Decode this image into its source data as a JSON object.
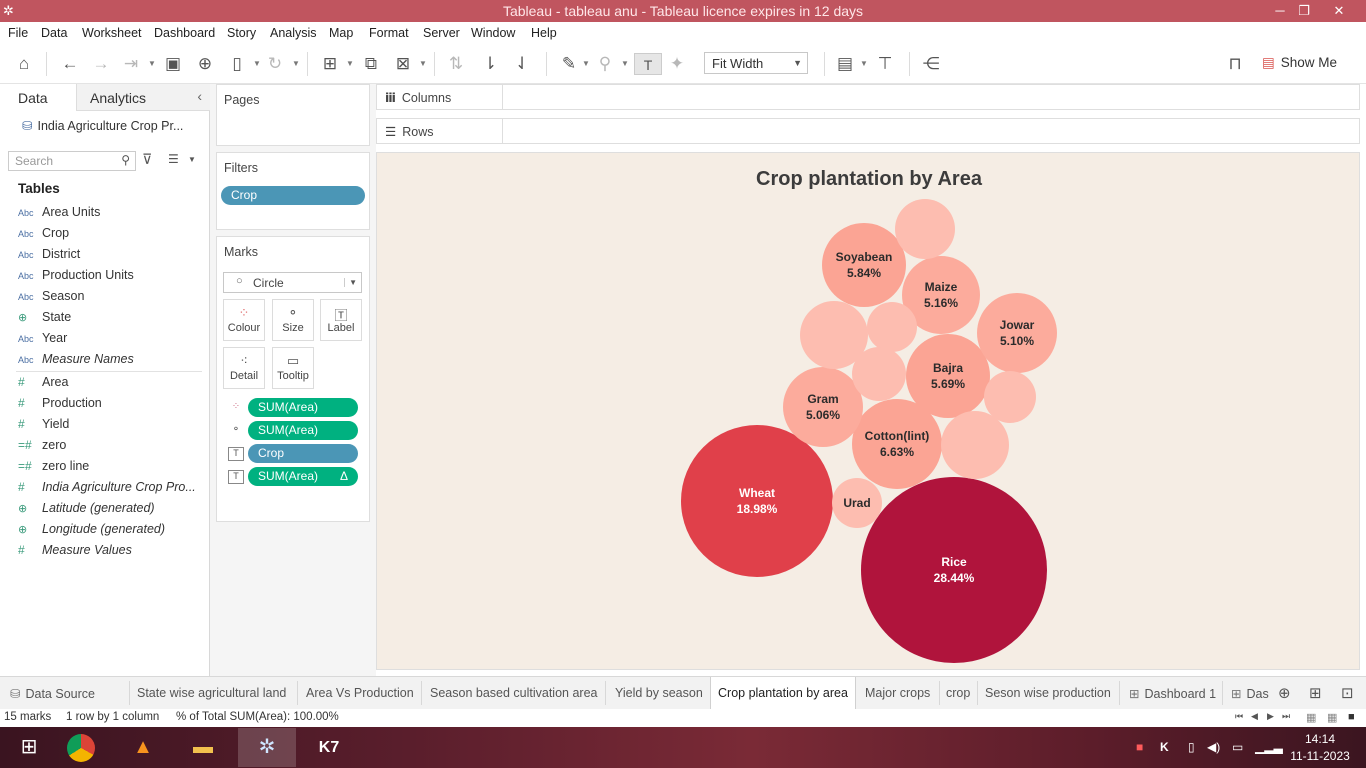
{
  "window": {
    "title": "Tableau - tableau anu - Tableau licence expires in 12 days"
  },
  "menu": [
    "File",
    "Data",
    "Worksheet",
    "Dashboard",
    "Story",
    "Analysis",
    "Map",
    "Format",
    "Server",
    "Window",
    "Help"
  ],
  "toolbar": {
    "fit": "Fit Width",
    "show_me": "Show Me"
  },
  "data_pane": {
    "tab_data": "Data",
    "tab_analytics": "Analytics",
    "datasource": "India Agriculture Crop Pr...",
    "search_placeholder": "Search",
    "tables_heading": "Tables",
    "fields": [
      {
        "icon": "Abc",
        "name": "Area Units"
      },
      {
        "icon": "Abc",
        "name": "Crop"
      },
      {
        "icon": "Abc",
        "name": "District"
      },
      {
        "icon": "Abc",
        "name": "Production Units"
      },
      {
        "icon": "Abc",
        "name": "Season"
      },
      {
        "icon": "globe",
        "name": "State"
      },
      {
        "icon": "Abc",
        "name": "Year"
      },
      {
        "icon": "Abc",
        "name": "Measure Names"
      },
      {
        "icon": "#",
        "name": "Area"
      },
      {
        "icon": "#",
        "name": "Production"
      },
      {
        "icon": "#",
        "name": "Yield"
      },
      {
        "icon": "=#",
        "name": "zero"
      },
      {
        "icon": "=#",
        "name": "zero line"
      },
      {
        "icon": "#",
        "name": "India Agriculture Crop Pro..."
      },
      {
        "icon": "globe",
        "name": "Latitude (generated)"
      },
      {
        "icon": "globe",
        "name": "Longitude (generated)"
      },
      {
        "icon": "#",
        "name": "Measure Values"
      }
    ]
  },
  "cards": {
    "pages": "Pages",
    "filters": "Filters",
    "filter_pill": "Crop",
    "marks": "Marks",
    "mark_type": "Circle",
    "buttons": [
      "Colour",
      "Size",
      "Label",
      "Detail",
      "Tooltip"
    ],
    "mark_pills": [
      {
        "icon": "colour",
        "label": "SUM(Area)",
        "color": "#00b180"
      },
      {
        "icon": "size",
        "label": "SUM(Area)",
        "color": "#00b180"
      },
      {
        "icon": "label",
        "label": "Crop",
        "color": "#4b96b6"
      },
      {
        "icon": "label",
        "label": "SUM(Area)",
        "color": "#00b180",
        "delta": "Δ"
      }
    ]
  },
  "shelves": {
    "columns": "Columns",
    "rows": "Rows"
  },
  "chart_data": {
    "type": "packed-bubble",
    "title": "Crop plantation  by Area",
    "measure": "% of Total SUM(Area)",
    "bubbles": [
      {
        "crop": "Rice",
        "pct": 28.44,
        "label": "28.44%",
        "color": "#b0143c"
      },
      {
        "crop": "Wheat",
        "pct": 18.98,
        "label": "18.98%",
        "color": "#e0404a"
      },
      {
        "crop": "Cotton(lint)",
        "pct": 6.63,
        "label": "6.63%",
        "color": "#fba494"
      },
      {
        "crop": "Soyabean",
        "pct": 5.84,
        "label": "5.84%",
        "color": "#fba494"
      },
      {
        "crop": "Bajra",
        "pct": 5.69,
        "label": "5.69%",
        "color": "#fba494"
      },
      {
        "crop": "Maize",
        "pct": 5.16,
        "label": "5.16%",
        "color": "#fcab9c"
      },
      {
        "crop": "Jowar",
        "pct": 5.1,
        "label": "5.10%",
        "color": "#fcab9c"
      },
      {
        "crop": "Gram",
        "pct": 5.06,
        "label": "5.06%",
        "color": "#fcab9c"
      },
      {
        "crop": "Urad",
        "label": "",
        "color": "#fdbdb0"
      },
      {
        "crop": "",
        "label": "",
        "color": "#fdbdb0"
      },
      {
        "crop": "",
        "label": "",
        "color": "#fdbdb0"
      },
      {
        "crop": "",
        "label": "",
        "color": "#fdbdb0"
      },
      {
        "crop": "",
        "label": "",
        "color": "#fdbdb0"
      },
      {
        "crop": "",
        "label": "",
        "color": "#fdbdb0"
      },
      {
        "crop": "",
        "label": "",
        "color": "#fdbdb0"
      }
    ]
  },
  "sheet_tabs": [
    "Data Source",
    "State wise agricultural land",
    "Area Vs Production",
    "Season based cultivation area",
    "Yield by season",
    "Crop plantation by area",
    "Major crops",
    "crop",
    "Seson wise production",
    "Dashboard 1",
    "Das"
  ],
  "active_tab": "Crop plantation by area",
  "status": {
    "marks": "15 marks",
    "rows": "1 row  by  1 column",
    "total": "% of Total SUM(Area): 100.00%"
  },
  "taskbar": {
    "time": "14:14",
    "date": "11-11-2023"
  }
}
